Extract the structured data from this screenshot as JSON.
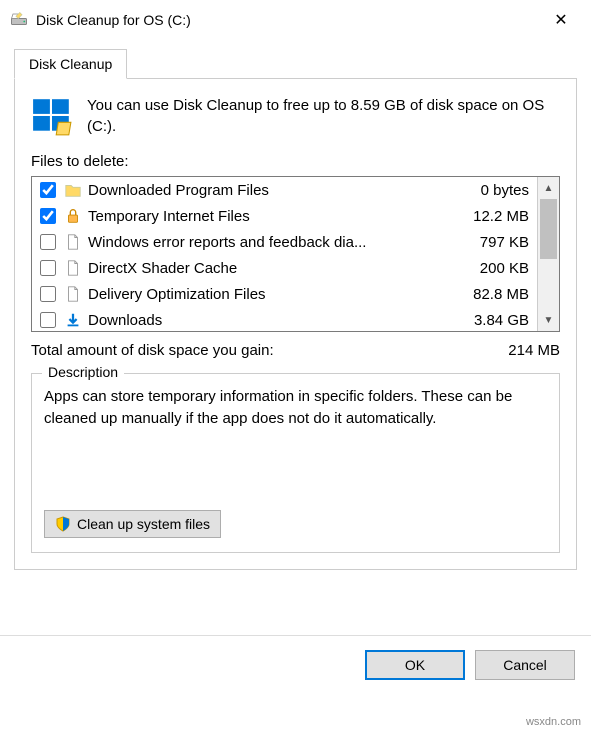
{
  "window": {
    "title": "Disk Cleanup for OS (C:)"
  },
  "tab": {
    "label": "Disk Cleanup"
  },
  "intro": "You can use Disk Cleanup to free up to 8.59 GB of disk space on OS (C:).",
  "files_label": "Files to delete:",
  "files": [
    {
      "checked": true,
      "icon": "folder",
      "name": "Downloaded Program Files",
      "size": "0 bytes"
    },
    {
      "checked": true,
      "icon": "lock",
      "name": "Temporary Internet Files",
      "size": "12.2 MB"
    },
    {
      "checked": false,
      "icon": "file",
      "name": "Windows error reports and feedback dia...",
      "size": "797 KB"
    },
    {
      "checked": false,
      "icon": "file",
      "name": "DirectX Shader Cache",
      "size": "200 KB"
    },
    {
      "checked": false,
      "icon": "file",
      "name": "Delivery Optimization Files",
      "size": "82.8 MB"
    },
    {
      "checked": false,
      "icon": "download",
      "name": "Downloads",
      "size": "3.84 GB"
    }
  ],
  "total": {
    "label": "Total amount of disk space you gain:",
    "value": "214 MB"
  },
  "description": {
    "legend": "Description",
    "text": "Apps can store temporary information in specific folders. These can be cleaned up manually if the app does not do it automatically."
  },
  "sys_button": "Clean up system files",
  "buttons": {
    "ok": "OK",
    "cancel": "Cancel"
  },
  "watermark": "wsxdn.com"
}
